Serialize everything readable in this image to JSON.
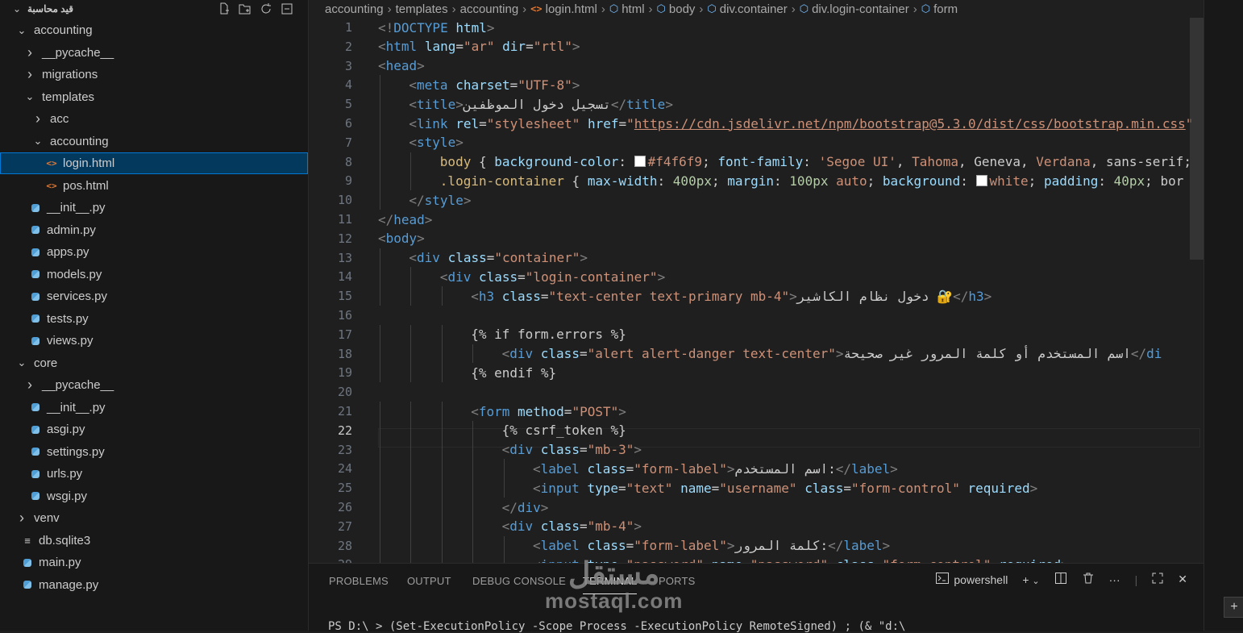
{
  "sidebar": {
    "title": "قيد محاسبة",
    "tree": [
      {
        "label": "accounting",
        "depth": 0,
        "kind": "folder-open"
      },
      {
        "label": "__pycache__",
        "depth": 1,
        "kind": "folder"
      },
      {
        "label": "migrations",
        "depth": 1,
        "kind": "folder"
      },
      {
        "label": "templates",
        "depth": 1,
        "kind": "folder-open"
      },
      {
        "label": "acc",
        "depth": 2,
        "kind": "folder"
      },
      {
        "label": "accounting",
        "depth": 2,
        "kind": "folder-open"
      },
      {
        "label": "login.html",
        "depth": 3,
        "kind": "html",
        "selected": true
      },
      {
        "label": "pos.html",
        "depth": 3,
        "kind": "html"
      },
      {
        "label": "__init__.py",
        "depth": 1,
        "kind": "py"
      },
      {
        "label": "admin.py",
        "depth": 1,
        "kind": "py"
      },
      {
        "label": "apps.py",
        "depth": 1,
        "kind": "py"
      },
      {
        "label": "models.py",
        "depth": 1,
        "kind": "py"
      },
      {
        "label": "services.py",
        "depth": 1,
        "kind": "py"
      },
      {
        "label": "tests.py",
        "depth": 1,
        "kind": "py"
      },
      {
        "label": "views.py",
        "depth": 1,
        "kind": "py"
      },
      {
        "label": "core",
        "depth": 0,
        "kind": "folder-open"
      },
      {
        "label": "__pycache__",
        "depth": 1,
        "kind": "folder"
      },
      {
        "label": "__init__.py",
        "depth": 1,
        "kind": "py"
      },
      {
        "label": "asgi.py",
        "depth": 1,
        "kind": "py"
      },
      {
        "label": "settings.py",
        "depth": 1,
        "kind": "py"
      },
      {
        "label": "urls.py",
        "depth": 1,
        "kind": "py"
      },
      {
        "label": "wsgi.py",
        "depth": 1,
        "kind": "py"
      },
      {
        "label": "venv",
        "depth": 0,
        "kind": "folder"
      },
      {
        "label": "db.sqlite3",
        "depth": 0,
        "kind": "db"
      },
      {
        "label": "main.py",
        "depth": 0,
        "kind": "py"
      },
      {
        "label": "manage.py",
        "depth": 0,
        "kind": "py"
      }
    ]
  },
  "breadcrumb": {
    "items": [
      "accounting",
      "templates",
      "accounting",
      "login.html",
      "html",
      "body",
      "div.container",
      "div.login-container",
      "form"
    ]
  },
  "editor": {
    "active_line": 22,
    "lines": [
      {
        "n": 1,
        "indent": 0,
        "parts": [
          [
            "t",
            "<!"
          ],
          [
            "tg",
            "DOCTYPE"
          ],
          [
            "tx",
            " "
          ],
          [
            "at",
            "html"
          ],
          [
            "t",
            ">"
          ]
        ]
      },
      {
        "n": 2,
        "indent": 0,
        "parts": [
          [
            "t",
            "<"
          ],
          [
            "tg",
            "html"
          ],
          [
            "tx",
            " "
          ],
          [
            "at",
            "lang"
          ],
          [
            "tx",
            "="
          ],
          [
            "st",
            "\"ar\""
          ],
          [
            "tx",
            " "
          ],
          [
            "at",
            "dir"
          ],
          [
            "tx",
            "="
          ],
          [
            "st",
            "\"rtl\""
          ],
          [
            "t",
            ">"
          ]
        ]
      },
      {
        "n": 3,
        "indent": 0,
        "parts": [
          [
            "t",
            "<"
          ],
          [
            "tg",
            "head"
          ],
          [
            "t",
            ">"
          ]
        ]
      },
      {
        "n": 4,
        "indent": 1,
        "parts": [
          [
            "t",
            "<"
          ],
          [
            "tg",
            "meta"
          ],
          [
            "tx",
            " "
          ],
          [
            "at",
            "charset"
          ],
          [
            "tx",
            "="
          ],
          [
            "st",
            "\"UTF-8\""
          ],
          [
            "t",
            ">"
          ]
        ]
      },
      {
        "n": 5,
        "indent": 1,
        "parts": [
          [
            "t",
            "<"
          ],
          [
            "tg",
            "title"
          ],
          [
            "t",
            ">"
          ],
          [
            "tx",
            "تسجيل دخول الموظفين"
          ],
          [
            "t",
            "</"
          ],
          [
            "tg",
            "title"
          ],
          [
            "t",
            ">"
          ]
        ]
      },
      {
        "n": 6,
        "indent": 1,
        "parts": [
          [
            "t",
            "<"
          ],
          [
            "tg",
            "link"
          ],
          [
            "tx",
            " "
          ],
          [
            "at",
            "rel"
          ],
          [
            "tx",
            "="
          ],
          [
            "st",
            "\"stylesheet\""
          ],
          [
            "tx",
            " "
          ],
          [
            "at",
            "href"
          ],
          [
            "tx",
            "="
          ],
          [
            "st",
            "\""
          ],
          [
            "url",
            "https://cdn.jsdelivr.net/npm/bootstrap@5.3.0/dist/css/bootstrap.min.css"
          ],
          [
            "st",
            "\""
          ]
        ]
      },
      {
        "n": 7,
        "indent": 1,
        "parts": [
          [
            "t",
            "<"
          ],
          [
            "tg",
            "style"
          ],
          [
            "t",
            ">"
          ]
        ]
      },
      {
        "n": 8,
        "indent": 2,
        "parts": [
          [
            "sel",
            "body"
          ],
          [
            "tx",
            " { "
          ],
          [
            "prop",
            "background-color"
          ],
          [
            "tx",
            ": "
          ],
          [
            "swatch",
            ""
          ],
          [
            "st",
            "#f4f6f9"
          ],
          [
            "tx",
            "; "
          ],
          [
            "prop",
            "font-family"
          ],
          [
            "tx",
            ": "
          ],
          [
            "st",
            "'Segoe UI'"
          ],
          [
            "tx",
            ", "
          ],
          [
            "st",
            "Tahoma"
          ],
          [
            "tx",
            ", Geneva, "
          ],
          [
            "st",
            "Verdana"
          ],
          [
            "tx",
            ", sans-serif;"
          ]
        ]
      },
      {
        "n": 9,
        "indent": 2,
        "parts": [
          [
            "sel",
            ".login-container"
          ],
          [
            "tx",
            " { "
          ],
          [
            "prop",
            "max-width"
          ],
          [
            "tx",
            ": "
          ],
          [
            "num",
            "400px"
          ],
          [
            "tx",
            "; "
          ],
          [
            "prop",
            "margin"
          ],
          [
            "tx",
            ": "
          ],
          [
            "num",
            "100px"
          ],
          [
            "tx",
            " "
          ],
          [
            "st",
            "auto"
          ],
          [
            "tx",
            "; "
          ],
          [
            "prop",
            "background"
          ],
          [
            "tx",
            ": "
          ],
          [
            "swatch",
            ""
          ],
          [
            "st",
            "white"
          ],
          [
            "tx",
            "; "
          ],
          [
            "prop",
            "padding"
          ],
          [
            "tx",
            ": "
          ],
          [
            "num",
            "40px"
          ],
          [
            "tx",
            "; bor"
          ]
        ]
      },
      {
        "n": 10,
        "indent": 1,
        "parts": [
          [
            "t",
            "</"
          ],
          [
            "tg",
            "style"
          ],
          [
            "t",
            ">"
          ]
        ]
      },
      {
        "n": 11,
        "indent": 0,
        "parts": [
          [
            "t",
            "</"
          ],
          [
            "tg",
            "head"
          ],
          [
            "t",
            ">"
          ]
        ]
      },
      {
        "n": 12,
        "indent": 0,
        "parts": [
          [
            "t",
            "<"
          ],
          [
            "tg",
            "body"
          ],
          [
            "t",
            ">"
          ]
        ]
      },
      {
        "n": 13,
        "indent": 1,
        "parts": [
          [
            "t",
            "<"
          ],
          [
            "tg",
            "div"
          ],
          [
            "tx",
            " "
          ],
          [
            "at",
            "class"
          ],
          [
            "tx",
            "="
          ],
          [
            "st",
            "\"container\""
          ],
          [
            "t",
            ">"
          ]
        ]
      },
      {
        "n": 14,
        "indent": 2,
        "parts": [
          [
            "t",
            "<"
          ],
          [
            "tg",
            "div"
          ],
          [
            "tx",
            " "
          ],
          [
            "at",
            "class"
          ],
          [
            "tx",
            "="
          ],
          [
            "st",
            "\"login-container\""
          ],
          [
            "t",
            ">"
          ]
        ]
      },
      {
        "n": 15,
        "indent": 3,
        "parts": [
          [
            "t",
            "<"
          ],
          [
            "tg",
            "h3"
          ],
          [
            "tx",
            " "
          ],
          [
            "at",
            "class"
          ],
          [
            "tx",
            "="
          ],
          [
            "st",
            "\"text-center text-primary mb-4\""
          ],
          [
            "t",
            ">"
          ],
          [
            "tx",
            "دخول نظام الكاشير 🔐"
          ],
          [
            "t",
            "</"
          ],
          [
            "tg",
            "h3"
          ],
          [
            "t",
            ">"
          ]
        ]
      },
      {
        "n": 16,
        "indent": 0,
        "parts": []
      },
      {
        "n": 17,
        "indent": 3,
        "parts": [
          [
            "tx",
            "{% if form.errors %}"
          ]
        ]
      },
      {
        "n": 18,
        "indent": 4,
        "parts": [
          [
            "t",
            "<"
          ],
          [
            "tg",
            "div"
          ],
          [
            "tx",
            " "
          ],
          [
            "at",
            "class"
          ],
          [
            "tx",
            "="
          ],
          [
            "st",
            "\"alert alert-danger text-center\""
          ],
          [
            "t",
            ">"
          ],
          [
            "tx",
            "اسم المستخدم أو كلمة المرور غير صحيحة"
          ],
          [
            "t",
            "</"
          ],
          [
            "tg",
            "di"
          ]
        ]
      },
      {
        "n": 19,
        "indent": 3,
        "parts": [
          [
            "tx",
            "{% endif %}"
          ]
        ]
      },
      {
        "n": 20,
        "indent": 0,
        "parts": []
      },
      {
        "n": 21,
        "indent": 3,
        "parts": [
          [
            "t",
            "<"
          ],
          [
            "tg",
            "form"
          ],
          [
            "tx",
            " "
          ],
          [
            "at",
            "method"
          ],
          [
            "tx",
            "="
          ],
          [
            "st",
            "\"POST\""
          ],
          [
            "t",
            ">"
          ]
        ]
      },
      {
        "n": 22,
        "indent": 4,
        "parts": [
          [
            "tx",
            "{% csrf_token %}"
          ]
        ]
      },
      {
        "n": 23,
        "indent": 4,
        "parts": [
          [
            "t",
            "<"
          ],
          [
            "tg",
            "div"
          ],
          [
            "tx",
            " "
          ],
          [
            "at",
            "class"
          ],
          [
            "tx",
            "="
          ],
          [
            "st",
            "\"mb-3\""
          ],
          [
            "t",
            ">"
          ]
        ]
      },
      {
        "n": 24,
        "indent": 5,
        "parts": [
          [
            "t",
            "<"
          ],
          [
            "tg",
            "label"
          ],
          [
            "tx",
            " "
          ],
          [
            "at",
            "class"
          ],
          [
            "tx",
            "="
          ],
          [
            "st",
            "\"form-label\""
          ],
          [
            "t",
            ">"
          ],
          [
            "tx",
            "اسم المستخدم:"
          ],
          [
            "t",
            "</"
          ],
          [
            "tg",
            "label"
          ],
          [
            "t",
            ">"
          ]
        ]
      },
      {
        "n": 25,
        "indent": 5,
        "parts": [
          [
            "t",
            "<"
          ],
          [
            "tg",
            "input"
          ],
          [
            "tx",
            " "
          ],
          [
            "at",
            "type"
          ],
          [
            "tx",
            "="
          ],
          [
            "st",
            "\"text\""
          ],
          [
            "tx",
            " "
          ],
          [
            "at",
            "name"
          ],
          [
            "tx",
            "="
          ],
          [
            "st",
            "\"username\""
          ],
          [
            "tx",
            " "
          ],
          [
            "at",
            "class"
          ],
          [
            "tx",
            "="
          ],
          [
            "st",
            "\"form-control\""
          ],
          [
            "tx",
            " "
          ],
          [
            "at",
            "required"
          ],
          [
            "t",
            ">"
          ]
        ]
      },
      {
        "n": 26,
        "indent": 4,
        "parts": [
          [
            "t",
            "</"
          ],
          [
            "tg",
            "div"
          ],
          [
            "t",
            ">"
          ]
        ]
      },
      {
        "n": 27,
        "indent": 4,
        "parts": [
          [
            "t",
            "<"
          ],
          [
            "tg",
            "div"
          ],
          [
            "tx",
            " "
          ],
          [
            "at",
            "class"
          ],
          [
            "tx",
            "="
          ],
          [
            "st",
            "\"mb-4\""
          ],
          [
            "t",
            ">"
          ]
        ]
      },
      {
        "n": 28,
        "indent": 5,
        "parts": [
          [
            "t",
            "<"
          ],
          [
            "tg",
            "label"
          ],
          [
            "tx",
            " "
          ],
          [
            "at",
            "class"
          ],
          [
            "tx",
            "="
          ],
          [
            "st",
            "\"form-label\""
          ],
          [
            "t",
            ">"
          ],
          [
            "tx",
            "كلمة المرور:"
          ],
          [
            "t",
            "</"
          ],
          [
            "tg",
            "label"
          ],
          [
            "t",
            ">"
          ]
        ]
      },
      {
        "n": 29,
        "indent": 5,
        "parts": [
          [
            "t",
            "<"
          ],
          [
            "tg",
            "input"
          ],
          [
            "tx",
            " "
          ],
          [
            "at",
            "type"
          ],
          [
            "tx",
            "="
          ],
          [
            "st",
            "\"password\""
          ],
          [
            "tx",
            " "
          ],
          [
            "at",
            "name"
          ],
          [
            "tx",
            "="
          ],
          [
            "st",
            "\"password\""
          ],
          [
            "tx",
            " "
          ],
          [
            "at",
            "class"
          ],
          [
            "tx",
            "="
          ],
          [
            "st",
            "\"form-control\""
          ],
          [
            "tx",
            " "
          ],
          [
            "at",
            "required"
          ],
          [
            "t",
            ">"
          ]
        ]
      }
    ]
  },
  "panel": {
    "tabs": [
      "PROBLEMS",
      "OUTPUT",
      "DEBUG CONSOLE",
      "TERMINAL",
      "PORTS"
    ],
    "active_tab": "TERMINAL",
    "terminal_name": "powershell",
    "terminal_line": "PS D:\\ > (Set-ExecutionPolicy -Scope Process -ExecutionPolicy RemoteSigned) ; (& \"d:\\"
  },
  "watermark": {
    "arabic": "مستقل",
    "latin": "mostaql.com"
  },
  "colors": {
    "accent": "#0078d4",
    "selection": "#04395e",
    "background": "#1f1f1f"
  }
}
